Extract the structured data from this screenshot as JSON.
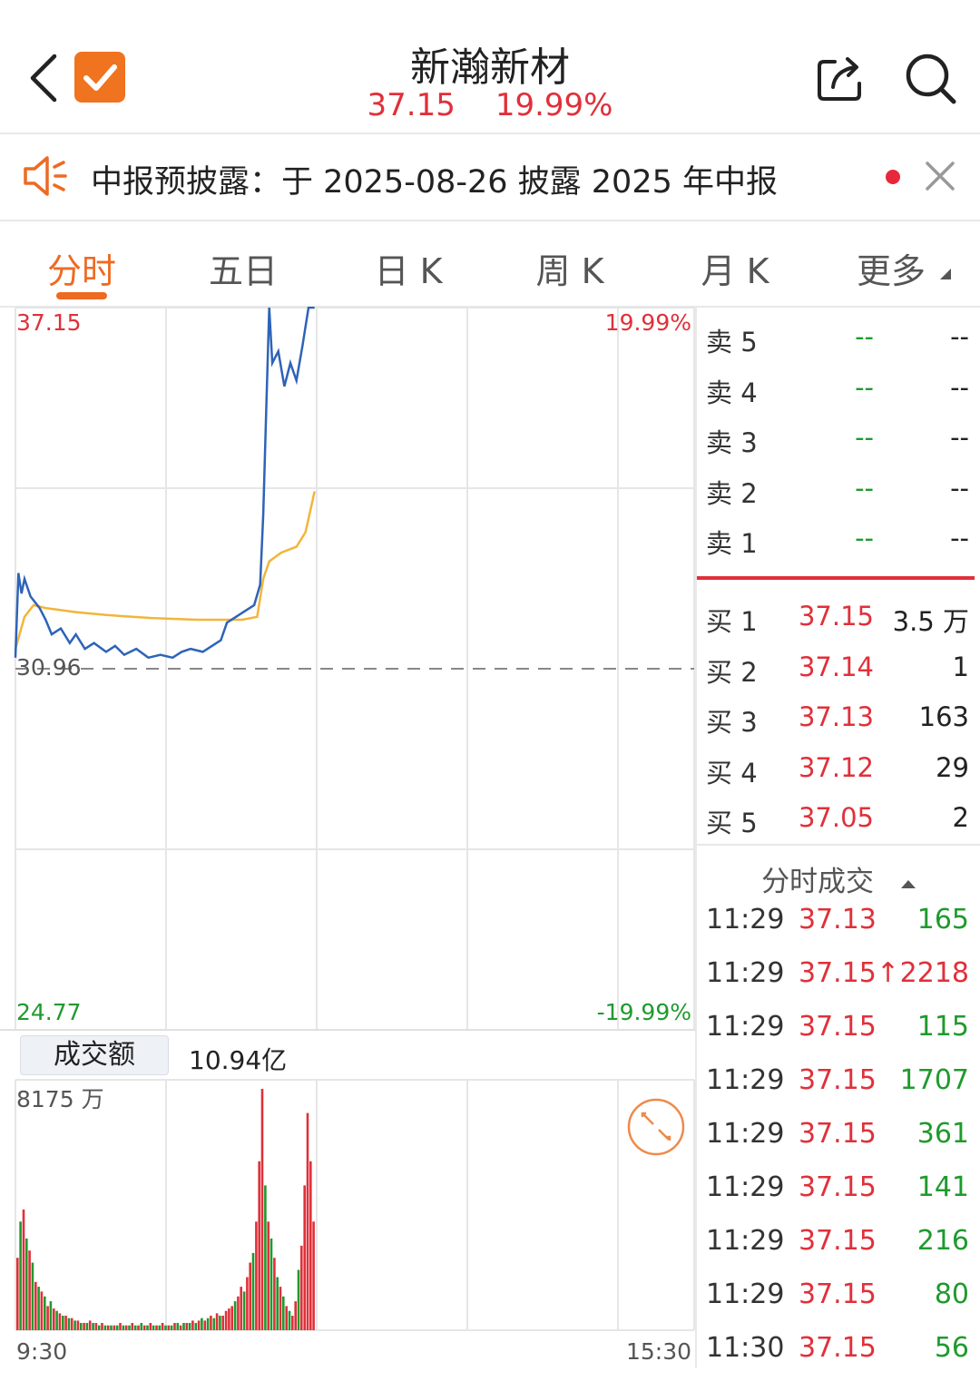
{
  "header": {
    "title": "新瀚新材",
    "price": "37.15",
    "change_pct": "19.99%"
  },
  "notice": {
    "text": "中报预披露：于 2025-08-26 披露 2025 年中报"
  },
  "tabs": [
    {
      "label": "分时",
      "active": true
    },
    {
      "label": "五日"
    },
    {
      "label": "日 K"
    },
    {
      "label": "周 K"
    },
    {
      "label": "月 K"
    },
    {
      "label": "更多"
    }
  ],
  "chart": {
    "price_high": "37.15",
    "pct_high": "19.99%",
    "prev_close": "30.96",
    "price_low": "24.77",
    "pct_low": "-19.99%",
    "volume_label": "成交额",
    "volume_total": "10.94亿",
    "volume_max": "8175 万",
    "time_start": "9:30",
    "time_end": "15:30"
  },
  "chart_data": {
    "type": "line",
    "x_range": [
      "9:30",
      "15:00"
    ],
    "ylim": [
      24.77,
      37.15
    ],
    "prev_close": 30.96,
    "series": [
      {
        "color": "#2e63b8",
        "points": [
          [
            0,
            31.15
          ],
          [
            1,
            32.6
          ],
          [
            2,
            32.25
          ],
          [
            3,
            32.5
          ],
          [
            5,
            32.2
          ],
          [
            8,
            32.0
          ],
          [
            10,
            31.8
          ],
          [
            12,
            31.55
          ],
          [
            15,
            31.65
          ],
          [
            18,
            31.4
          ],
          [
            20,
            31.55
          ],
          [
            23,
            31.3
          ],
          [
            26,
            31.4
          ],
          [
            30,
            31.25
          ],
          [
            33,
            31.35
          ],
          [
            36,
            31.2
          ],
          [
            40,
            31.3
          ],
          [
            44,
            31.15
          ],
          [
            48,
            31.2
          ],
          [
            52,
            31.15
          ],
          [
            55,
            31.25
          ],
          [
            58,
            31.3
          ],
          [
            62,
            31.25
          ],
          [
            65,
            31.35
          ],
          [
            68,
            31.45
          ],
          [
            70,
            31.75
          ],
          [
            73,
            31.85
          ],
          [
            76,
            31.95
          ],
          [
            79,
            32.05
          ],
          [
            81,
            32.4
          ],
          [
            82,
            33.6
          ],
          [
            83,
            35.4
          ],
          [
            84,
            37.15
          ],
          [
            85,
            36.2
          ],
          [
            87,
            36.4
          ],
          [
            89,
            35.8
          ],
          [
            91,
            36.2
          ],
          [
            93,
            35.9
          ],
          [
            95,
            36.5
          ],
          [
            97,
            37.15
          ],
          [
            99,
            37.15
          ]
        ]
      },
      {
        "color": "#f2b53a",
        "points": [
          [
            0,
            31.3
          ],
          [
            3,
            31.85
          ],
          [
            6,
            32.05
          ],
          [
            10,
            32.0
          ],
          [
            20,
            31.93
          ],
          [
            30,
            31.88
          ],
          [
            45,
            31.83
          ],
          [
            60,
            31.8
          ],
          [
            75,
            31.8
          ],
          [
            80,
            31.85
          ],
          [
            82,
            32.5
          ],
          [
            84,
            32.8
          ],
          [
            88,
            32.95
          ],
          [
            93,
            33.05
          ],
          [
            96,
            33.3
          ],
          [
            99,
            34.0
          ]
        ]
      }
    ],
    "volume": {
      "max_label": "8175 万",
      "bars": [
        {
          "v": 30,
          "c": "r"
        },
        {
          "v": 45,
          "c": "g"
        },
        {
          "v": 50,
          "c": "r"
        },
        {
          "v": 38,
          "c": "g"
        },
        {
          "v": 33,
          "c": "r"
        },
        {
          "v": 28,
          "c": "g"
        },
        {
          "v": 20,
          "c": "r"
        },
        {
          "v": 18,
          "c": "g"
        },
        {
          "v": 16,
          "c": "r"
        },
        {
          "v": 14,
          "c": "g"
        },
        {
          "v": 10,
          "c": "r"
        },
        {
          "v": 12,
          "c": "g"
        },
        {
          "v": 9,
          "c": "r"
        },
        {
          "v": 8,
          "c": "g"
        },
        {
          "v": 7,
          "c": "r"
        },
        {
          "v": 6,
          "c": "g"
        },
        {
          "v": 6,
          "c": "r"
        },
        {
          "v": 5,
          "c": "g"
        },
        {
          "v": 5,
          "c": "r"
        },
        {
          "v": 4,
          "c": "g"
        },
        {
          "v": 4,
          "c": "r"
        },
        {
          "v": 3,
          "c": "g"
        },
        {
          "v": 3,
          "c": "r"
        },
        {
          "v": 3,
          "c": "g"
        },
        {
          "v": 4,
          "c": "r"
        },
        {
          "v": 3,
          "c": "g"
        },
        {
          "v": 3,
          "c": "r"
        },
        {
          "v": 2,
          "c": "g"
        },
        {
          "v": 3,
          "c": "r"
        },
        {
          "v": 2,
          "c": "g"
        },
        {
          "v": 2,
          "c": "r"
        },
        {
          "v": 2,
          "c": "g"
        },
        {
          "v": 2,
          "c": "r"
        },
        {
          "v": 2,
          "c": "g"
        },
        {
          "v": 3,
          "c": "r"
        },
        {
          "v": 2,
          "c": "g"
        },
        {
          "v": 2,
          "c": "r"
        },
        {
          "v": 2,
          "c": "g"
        },
        {
          "v": 3,
          "c": "r"
        },
        {
          "v": 2,
          "c": "g"
        },
        {
          "v": 2,
          "c": "r"
        },
        {
          "v": 3,
          "c": "g"
        },
        {
          "v": 2,
          "c": "r"
        },
        {
          "v": 2,
          "c": "g"
        },
        {
          "v": 3,
          "c": "r"
        },
        {
          "v": 2,
          "c": "g"
        },
        {
          "v": 2,
          "c": "r"
        },
        {
          "v": 2,
          "c": "g"
        },
        {
          "v": 3,
          "c": "r"
        },
        {
          "v": 2,
          "c": "g"
        },
        {
          "v": 2,
          "c": "r"
        },
        {
          "v": 2,
          "c": "g"
        },
        {
          "v": 3,
          "c": "r"
        },
        {
          "v": 3,
          "c": "g"
        },
        {
          "v": 2,
          "c": "r"
        },
        {
          "v": 3,
          "c": "g"
        },
        {
          "v": 3,
          "c": "r"
        },
        {
          "v": 3,
          "c": "g"
        },
        {
          "v": 4,
          "c": "r"
        },
        {
          "v": 3,
          "c": "g"
        },
        {
          "v": 4,
          "c": "r"
        },
        {
          "v": 5,
          "c": "g"
        },
        {
          "v": 4,
          "c": "r"
        },
        {
          "v": 5,
          "c": "g"
        },
        {
          "v": 6,
          "c": "r"
        },
        {
          "v": 5,
          "c": "g"
        },
        {
          "v": 7,
          "c": "r"
        },
        {
          "v": 6,
          "c": "g"
        },
        {
          "v": 6,
          "c": "r"
        },
        {
          "v": 8,
          "c": "r"
        },
        {
          "v": 9,
          "c": "r"
        },
        {
          "v": 10,
          "c": "r"
        },
        {
          "v": 12,
          "c": "g"
        },
        {
          "v": 14,
          "c": "r"
        },
        {
          "v": 18,
          "c": "r"
        },
        {
          "v": 16,
          "c": "g"
        },
        {
          "v": 22,
          "c": "r"
        },
        {
          "v": 28,
          "c": "r"
        },
        {
          "v": 32,
          "c": "g"
        },
        {
          "v": 45,
          "c": "r"
        },
        {
          "v": 70,
          "c": "r"
        },
        {
          "v": 100,
          "c": "r"
        },
        {
          "v": 60,
          "c": "g"
        },
        {
          "v": 45,
          "c": "r"
        },
        {
          "v": 38,
          "c": "g"
        },
        {
          "v": 30,
          "c": "r"
        },
        {
          "v": 22,
          "c": "g"
        },
        {
          "v": 18,
          "c": "r"
        },
        {
          "v": 14,
          "c": "g"
        },
        {
          "v": 10,
          "c": "r"
        },
        {
          "v": 8,
          "c": "g"
        },
        {
          "v": 6,
          "c": "r"
        },
        {
          "v": 12,
          "c": "r"
        },
        {
          "v": 25,
          "c": "g"
        },
        {
          "v": 35,
          "c": "r"
        },
        {
          "v": 60,
          "c": "r"
        },
        {
          "v": 90,
          "c": "r"
        },
        {
          "v": 70,
          "c": "r"
        },
        {
          "v": 45,
          "c": "r"
        }
      ]
    }
  },
  "order_book": {
    "asks": [
      {
        "label": "卖 5",
        "price": "--",
        "vol": "--"
      },
      {
        "label": "卖 4",
        "price": "--",
        "vol": "--"
      },
      {
        "label": "卖 3",
        "price": "--",
        "vol": "--"
      },
      {
        "label": "卖 2",
        "price": "--",
        "vol": "--"
      },
      {
        "label": "卖 1",
        "price": "--",
        "vol": "--"
      }
    ],
    "bids": [
      {
        "label": "买 1",
        "price": "37.15",
        "vol": "3.5 万"
      },
      {
        "label": "买 2",
        "price": "37.14",
        "vol": "1"
      },
      {
        "label": "买 3",
        "price": "37.13",
        "vol": "163"
      },
      {
        "label": "买 4",
        "price": "37.12",
        "vol": "29"
      },
      {
        "label": "买 5",
        "price": "37.05",
        "vol": "2"
      }
    ]
  },
  "trades": {
    "title": "分时成交",
    "rows": [
      {
        "time": "11:29",
        "price": "37.13",
        "vol": "165",
        "vcolor": "green"
      },
      {
        "time": "11:29",
        "price": "37.15↑",
        "vol": "2218",
        "vcolor": "red"
      },
      {
        "time": "11:29",
        "price": "37.15",
        "vol": "115",
        "vcolor": "green"
      },
      {
        "time": "11:29",
        "price": "37.15",
        "vol": "1707",
        "vcolor": "green"
      },
      {
        "time": "11:29",
        "price": "37.15",
        "vol": "361",
        "vcolor": "green"
      },
      {
        "time": "11:29",
        "price": "37.15",
        "vol": "141",
        "vcolor": "green"
      },
      {
        "time": "11:29",
        "price": "37.15",
        "vol": "216",
        "vcolor": "green"
      },
      {
        "time": "11:29",
        "price": "37.15",
        "vol": "80",
        "vcolor": "green"
      },
      {
        "time": "11:30",
        "price": "37.15",
        "vol": "56",
        "vcolor": "green"
      }
    ]
  },
  "colors": {
    "up": "#e0303a",
    "down": "#1f9a2e",
    "accent": "#ee6a23",
    "price_line": "#2e63b8",
    "avg_line": "#f2b53a"
  }
}
